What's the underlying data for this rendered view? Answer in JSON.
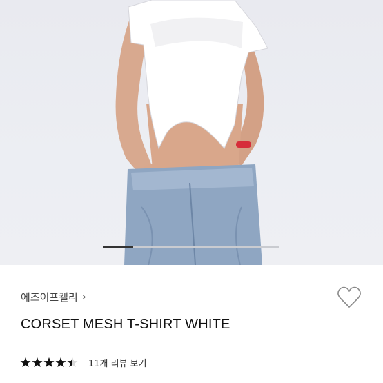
{
  "product": {
    "brand": "에즈이프캘리",
    "title": "CORSET MESH T-SHIRT WHITE",
    "rating": 4.5,
    "reviews_link": "11개 리뷰 보기"
  },
  "gallery": {
    "progress": 0.17
  },
  "icons": {
    "brand_chevron": "chevron-right-icon",
    "wishlist": "heart-outline-icon",
    "star": "star-icon"
  },
  "colors": {
    "hero_bg": "#eceef3",
    "text_primary": "#111111",
    "pager_active": "#333333",
    "pager_track": "#c9cbd0"
  }
}
